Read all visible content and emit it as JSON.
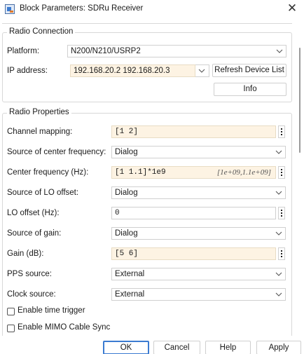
{
  "window": {
    "title": "Block Parameters: SDRu Receiver",
    "close_glyph": "✕"
  },
  "radio_connection": {
    "group_title": "Radio Connection",
    "platform_label": "Platform:",
    "platform_value": "N200/N210/USRP2",
    "ip_label": "IP address:",
    "ip_value": "192.168.20.2 192.168.20.3",
    "refresh_button": "Refresh Device List",
    "info_button": "Info"
  },
  "radio_properties": {
    "group_title": "Radio Properties",
    "channel_mapping_label": "Channel mapping:",
    "channel_mapping_value": "[1 2]",
    "center_freq_source_label": "Source of center frequency:",
    "center_freq_source_value": "Dialog",
    "center_freq_label": "Center frequency (Hz):",
    "center_freq_value": "[1 1.1]*1e9",
    "center_freq_hint": "[1e+09,1.1e+09]",
    "lo_source_label": "Source of LO offset:",
    "lo_source_value": "Dialog",
    "lo_offset_label": "LO offset (Hz):",
    "lo_offset_value": "0",
    "gain_source_label": "Source of gain:",
    "gain_source_value": "Dialog",
    "gain_label": "Gain (dB):",
    "gain_value": "[5 6]",
    "pps_label": "PPS source:",
    "pps_value": "External",
    "clock_label": "Clock source:",
    "clock_value": "External",
    "time_trigger_label": "Enable time trigger",
    "time_trigger_checked": false,
    "mimo_label": "Enable MIMO Cable Sync",
    "mimo_checked": false
  },
  "footer": {
    "ok": "OK",
    "cancel": "Cancel",
    "help": "Help",
    "apply": "Apply"
  },
  "colors": {
    "editable_field": "#fdf3e3",
    "default_button_border": "#3b7bd1"
  },
  "icons": {
    "app": "simulink-block-icon",
    "close": "close-icon",
    "dropdown": "chevron-down-icon",
    "menu": "kebab-menu-icon"
  }
}
